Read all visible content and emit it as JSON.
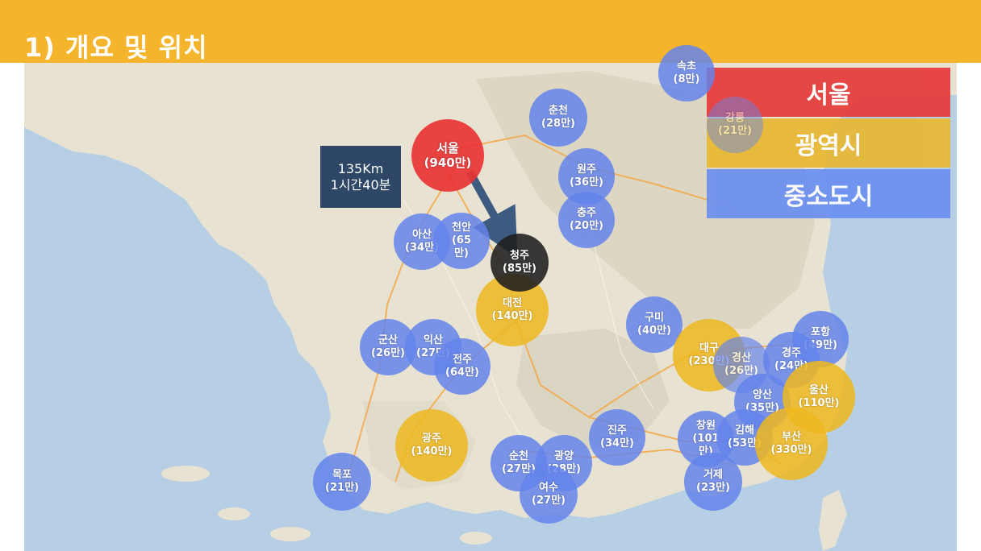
{
  "title": "1) 개요 및 위치",
  "distance": {
    "km": "135Km",
    "time": "1시간40분"
  },
  "legend": [
    {
      "label": "서울",
      "color": "#e53a3a"
    },
    {
      "label": "광역시",
      "color": "#e8b832"
    },
    {
      "label": "중소도시",
      "color": "#6b8ff0"
    }
  ],
  "cities": {
    "sokcho": {
      "name": "속초",
      "pop": "(8만)"
    },
    "gangneung": {
      "name": "강릉",
      "pop": "(21만)"
    },
    "chuncheon": {
      "name": "춘천",
      "pop": "(28만)"
    },
    "seoul": {
      "name": "서울",
      "pop": "(940만)"
    },
    "wonju": {
      "name": "원주",
      "pop": "(36만)"
    },
    "chungju": {
      "name": "충주",
      "pop": "(20만)"
    },
    "asan": {
      "name": "아산",
      "pop": "(34만)"
    },
    "cheonan": {
      "name": "천안",
      "pop": "(65\n만)"
    },
    "cheongju": {
      "name": "청주",
      "pop": "(85만)"
    },
    "daejeon": {
      "name": "대전",
      "pop": "(140만)"
    },
    "gumi": {
      "name": "구미",
      "pop": "(40만)"
    },
    "pohang": {
      "name": "포항",
      "pop": "(49만)"
    },
    "daegu": {
      "name": "대구",
      "pop": "(230만)"
    },
    "gyeongsan": {
      "name": "경산",
      "pop": "(26만)"
    },
    "gyeongju": {
      "name": "경주",
      "pop": "(24만)"
    },
    "gunsan": {
      "name": "군산",
      "pop": "(26만)"
    },
    "iksan": {
      "name": "익산",
      "pop": "(27만)"
    },
    "jeonju": {
      "name": "전주",
      "pop": "(64만)"
    },
    "ulsan": {
      "name": "울산",
      "pop": "(110만)"
    },
    "yangsan": {
      "name": "양산",
      "pop": "(35만)"
    },
    "gwangju": {
      "name": "광주",
      "pop": "(140만)"
    },
    "jinju": {
      "name": "진주",
      "pop": "(34만)"
    },
    "changwon": {
      "name": "창원",
      "pop": "(101\n만)"
    },
    "gimhae": {
      "name": "김해",
      "pop": "(53만)"
    },
    "busan": {
      "name": "부산",
      "pop": "(330만)"
    },
    "suncheon": {
      "name": "순천",
      "pop": "(27만)"
    },
    "gwangyang": {
      "name": "광양",
      "pop": "(28만)"
    },
    "mokpo": {
      "name": "목포",
      "pop": "(21만)"
    },
    "geoje": {
      "name": "거제",
      "pop": "(23만)"
    },
    "yeosu": {
      "name": "여수",
      "pop": "(27만)"
    }
  }
}
